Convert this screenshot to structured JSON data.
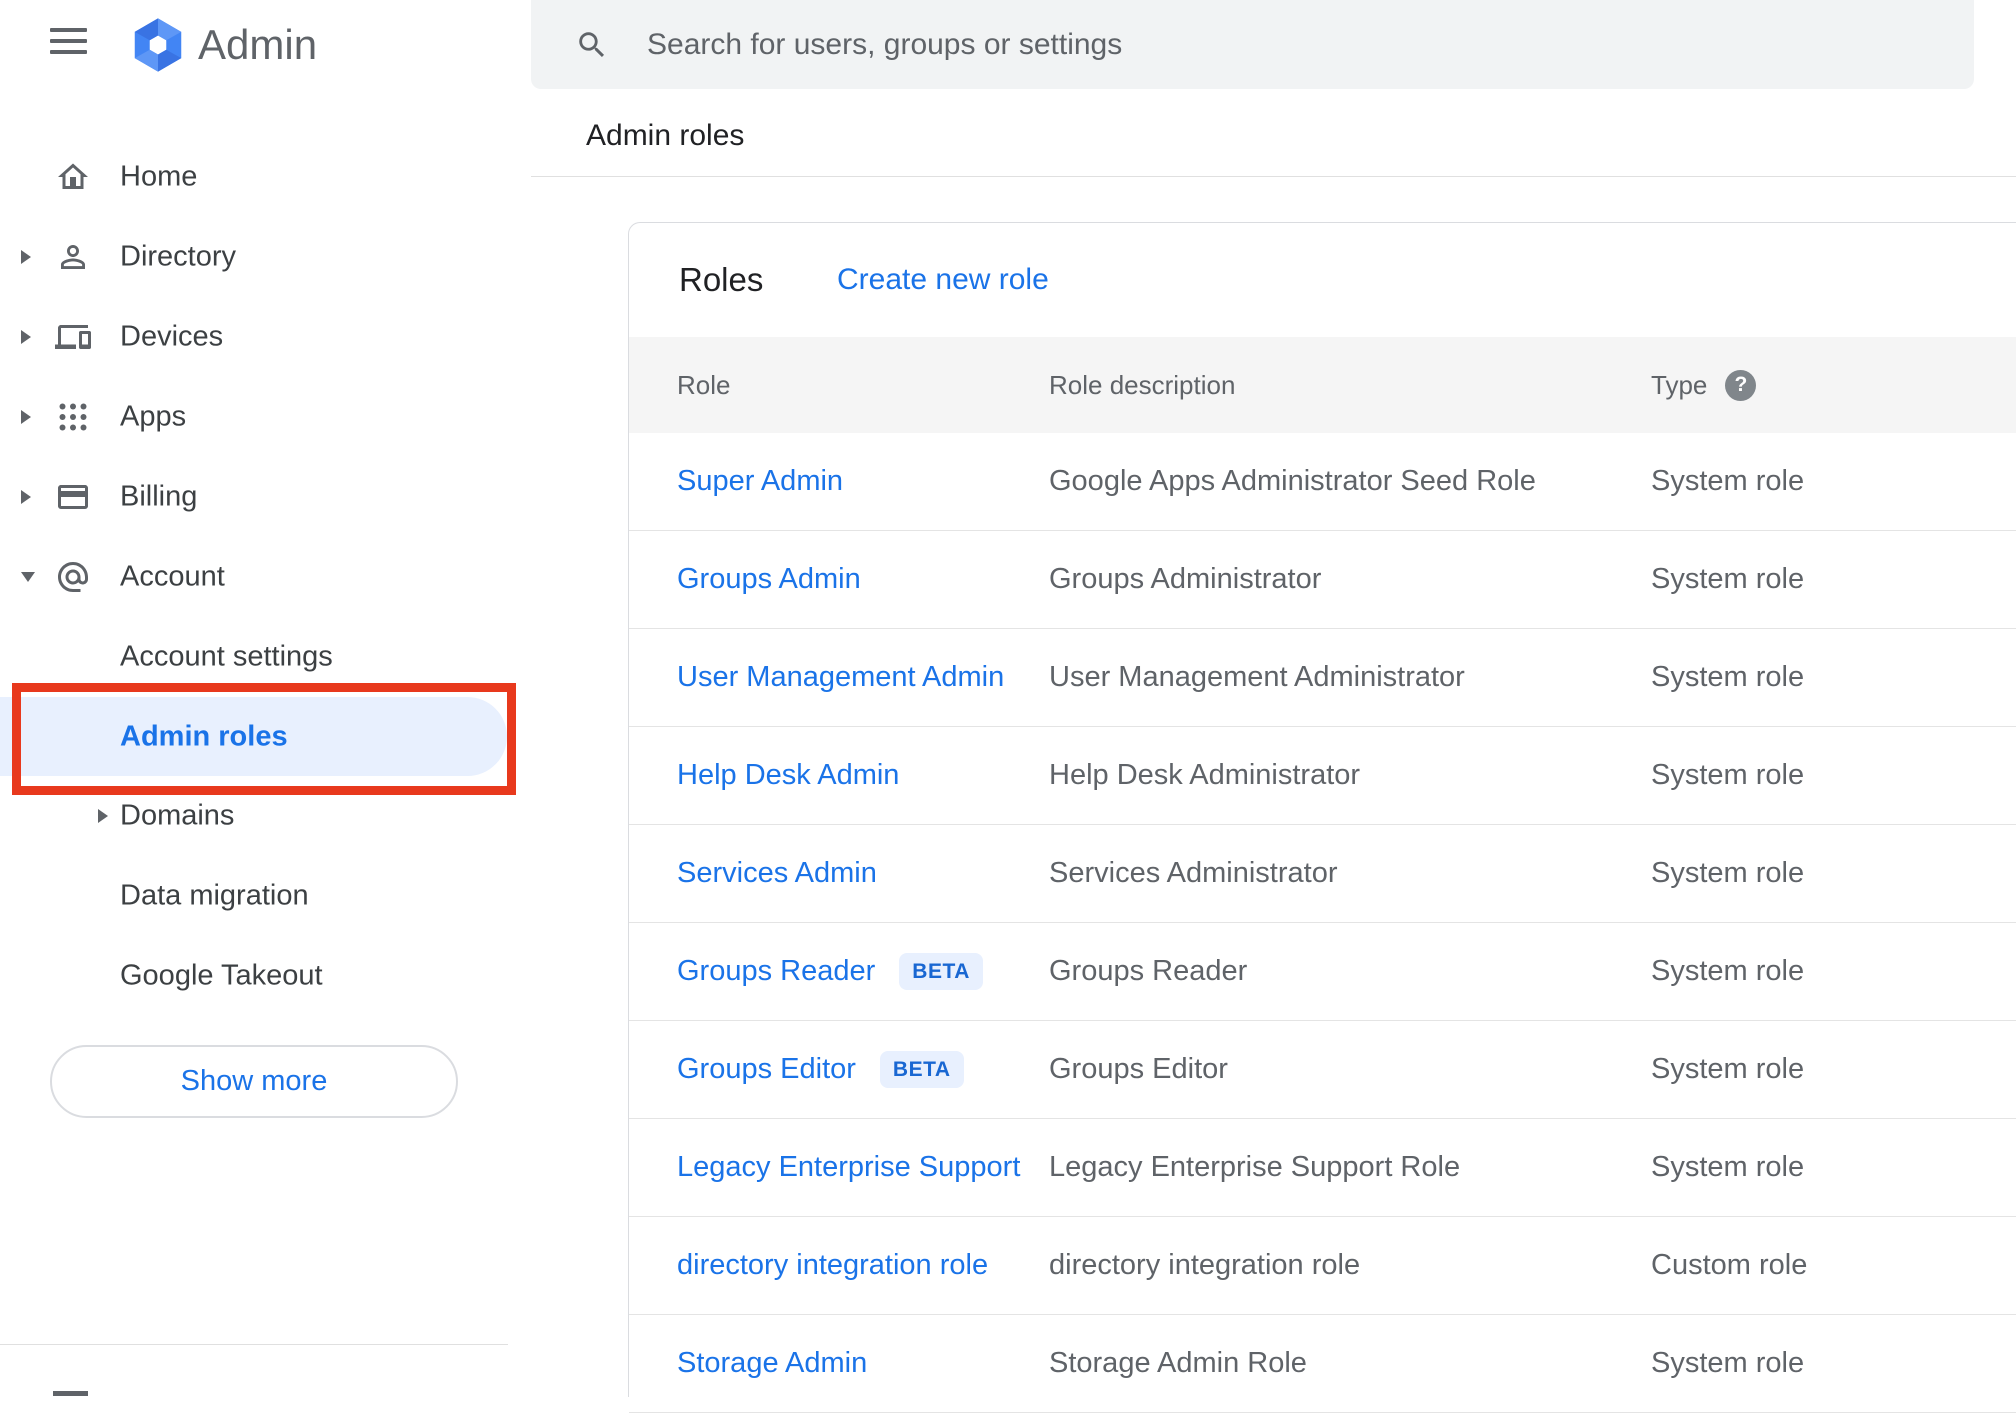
{
  "app": {
    "hamburger_icon": "menu-icon",
    "logo_icon": "admin-hexagon-logo",
    "logo_text": "Admin"
  },
  "search": {
    "icon": "search-icon",
    "placeholder": "Search for users, groups or settings"
  },
  "breadcrumb": "Admin roles",
  "sidebar": {
    "items": [
      {
        "label": "Home",
        "icon": "home-icon",
        "arrow": "none",
        "indent": false,
        "active": false
      },
      {
        "label": "Directory",
        "icon": "person-icon",
        "arrow": "collapsed",
        "indent": false,
        "active": false
      },
      {
        "label": "Devices",
        "icon": "devices-icon",
        "arrow": "collapsed",
        "indent": false,
        "active": false
      },
      {
        "label": "Apps",
        "icon": "apps-grid-icon",
        "arrow": "collapsed",
        "indent": false,
        "active": false
      },
      {
        "label": "Billing",
        "icon": "credit-card-icon",
        "arrow": "collapsed",
        "indent": false,
        "active": false
      },
      {
        "label": "Account",
        "icon": "at-sign-icon",
        "arrow": "expanded",
        "indent": false,
        "active": false
      },
      {
        "label": "Account settings",
        "icon": null,
        "arrow": "none",
        "indent": true,
        "active": false
      },
      {
        "label": "Admin roles",
        "icon": null,
        "arrow": "none",
        "indent": true,
        "active": true
      },
      {
        "label": "Domains",
        "icon": null,
        "arrow": "collapsed",
        "indent": true,
        "active": false
      },
      {
        "label": "Data migration",
        "icon": null,
        "arrow": "none",
        "indent": true,
        "active": false
      },
      {
        "label": "Google Takeout",
        "icon": null,
        "arrow": "none",
        "indent": true,
        "active": false
      }
    ],
    "show_more_label": "Show more"
  },
  "main": {
    "title": "Roles",
    "create_link": "Create new role",
    "table": {
      "columns": [
        "Role",
        "Role description",
        "Type"
      ],
      "type_help_icon": "help-icon",
      "beta_label": "BETA",
      "rows": [
        {
          "role": "Super Admin",
          "beta": false,
          "description": "Google Apps Administrator Seed Role",
          "type": "System role"
        },
        {
          "role": "Groups Admin",
          "beta": false,
          "description": "Groups Administrator",
          "type": "System role"
        },
        {
          "role": "User Management Admin",
          "beta": false,
          "description": "User Management Administrator",
          "type": "System role"
        },
        {
          "role": "Help Desk Admin",
          "beta": false,
          "description": "Help Desk Administrator",
          "type": "System role"
        },
        {
          "role": "Services Admin",
          "beta": false,
          "description": "Services Administrator",
          "type": "System role"
        },
        {
          "role": "Groups Reader",
          "beta": true,
          "description": "Groups Reader",
          "type": "System role"
        },
        {
          "role": "Groups Editor",
          "beta": true,
          "description": "Groups Editor",
          "type": "System role"
        },
        {
          "role": "Legacy Enterprise Support",
          "beta": false,
          "description": "Legacy Enterprise Support Role",
          "type": "System role"
        },
        {
          "role": "directory integration role",
          "beta": false,
          "description": "directory integration role",
          "type": "Custom role"
        },
        {
          "role": "Storage Admin",
          "beta": false,
          "description": "Storage Admin Role",
          "type": "System role"
        }
      ]
    }
  },
  "annotation": {
    "shape": "red-highlight-box",
    "target": "Admin roles"
  },
  "colors": {
    "accent_blue": "#1a73e8",
    "active_pill_bg": "#e8f0fe",
    "annotation_red": "#e8391d",
    "beta_badge_bg": "#e8f0fe",
    "beta_badge_text": "#1967d2",
    "header_row_bg": "#f5f5f5",
    "searchbar_bg": "#f1f3f4"
  }
}
